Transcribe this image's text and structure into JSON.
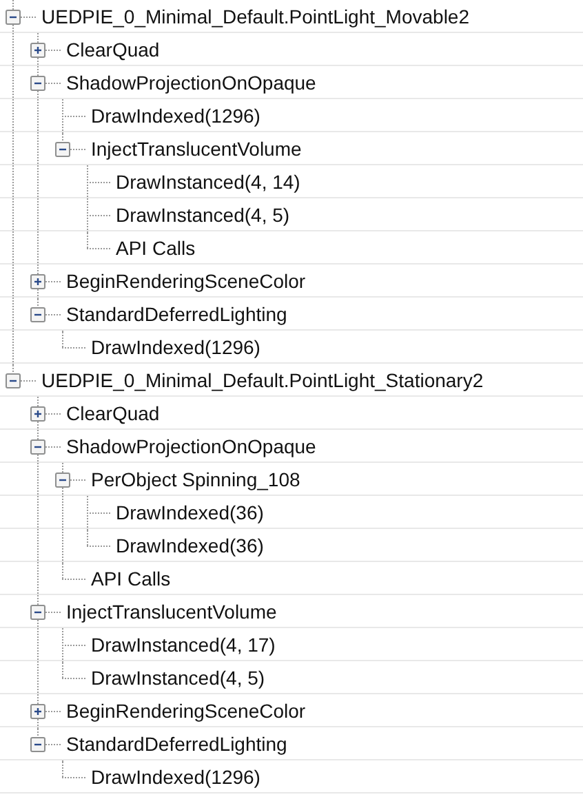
{
  "tree": [
    {
      "label": "UEDPIE_0_Minimal_Default.PointLight_Movable2",
      "expanded": true,
      "children": [
        {
          "label": "ClearQuad",
          "expanded": false
        },
        {
          "label": "ShadowProjectionOnOpaque",
          "expanded": true,
          "children": [
            {
              "label": "DrawIndexed(1296)"
            },
            {
              "label": "InjectTranslucentVolume",
              "expanded": true,
              "children": [
                {
                  "label": "DrawInstanced(4, 14)"
                },
                {
                  "label": "DrawInstanced(4, 5)"
                },
                {
                  "label": "API Calls"
                }
              ]
            }
          ]
        },
        {
          "label": "BeginRenderingSceneColor",
          "expanded": false
        },
        {
          "label": "StandardDeferredLighting",
          "expanded": true,
          "children": [
            {
              "label": "DrawIndexed(1296)"
            }
          ]
        }
      ]
    },
    {
      "label": "UEDPIE_0_Minimal_Default.PointLight_Stationary2",
      "expanded": true,
      "children": [
        {
          "label": "ClearQuad",
          "expanded": false
        },
        {
          "label": "ShadowProjectionOnOpaque",
          "expanded": true,
          "children": [
            {
              "label": "PerObject Spinning_108",
              "expanded": true,
              "children": [
                {
                  "label": "DrawIndexed(36)"
                },
                {
                  "label": "DrawIndexed(36)"
                }
              ]
            },
            {
              "label": "API Calls"
            }
          ]
        },
        {
          "label": "InjectTranslucentVolume",
          "expanded": true,
          "children": [
            {
              "label": "DrawInstanced(4, 17)"
            },
            {
              "label": "DrawInstanced(4, 5)"
            }
          ]
        },
        {
          "label": "BeginRenderingSceneColor",
          "expanded": false
        },
        {
          "label": "StandardDeferredLighting",
          "expanded": true,
          "children": [
            {
              "label": "DrawIndexed(1296)"
            }
          ]
        }
      ]
    }
  ]
}
